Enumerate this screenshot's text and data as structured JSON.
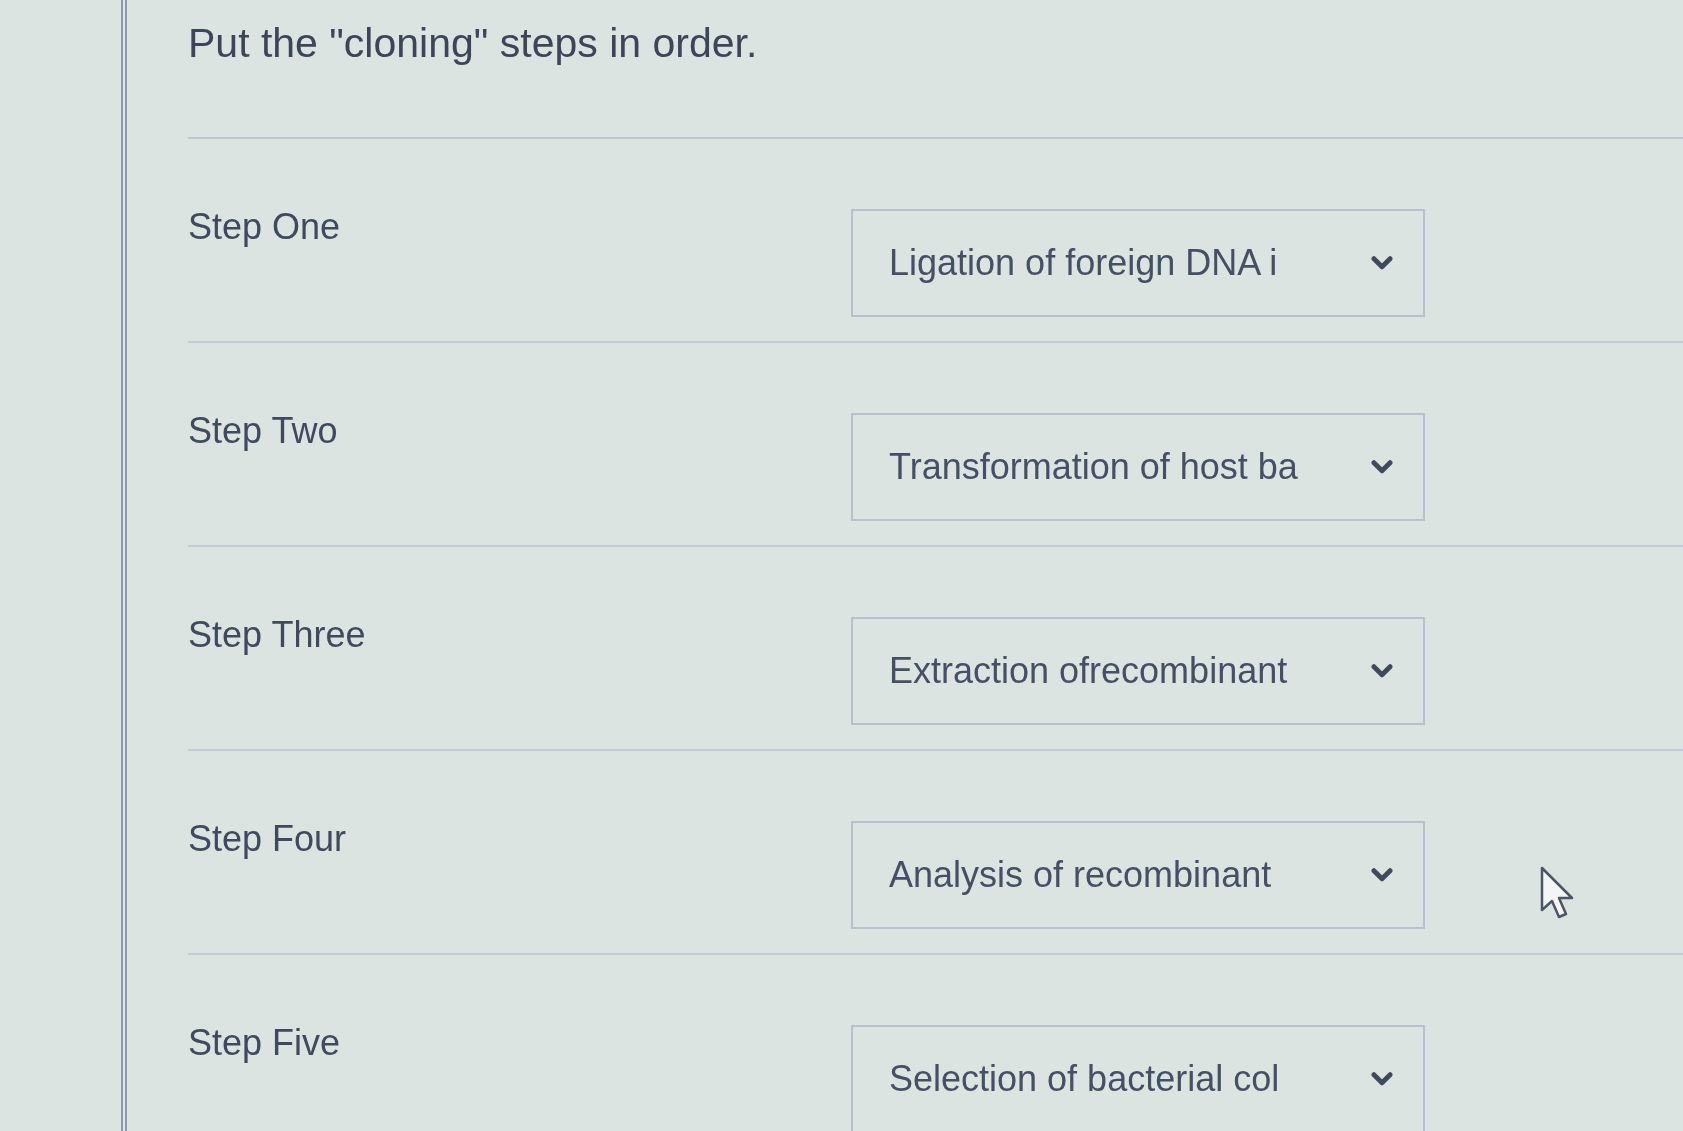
{
  "question": "Put the \"cloning\" steps in order.",
  "steps": [
    {
      "label": "Step One",
      "value": "Ligation of foreign DNA i"
    },
    {
      "label": "Step Two",
      "value": "Transformation of host ba"
    },
    {
      "label": "Step Three",
      "value": "Extraction ofrecombinant"
    },
    {
      "label": "Step Four",
      "value": "Analysis of recombinant"
    },
    {
      "label": "Step Five",
      "value": "Selection of bacterial col"
    }
  ]
}
